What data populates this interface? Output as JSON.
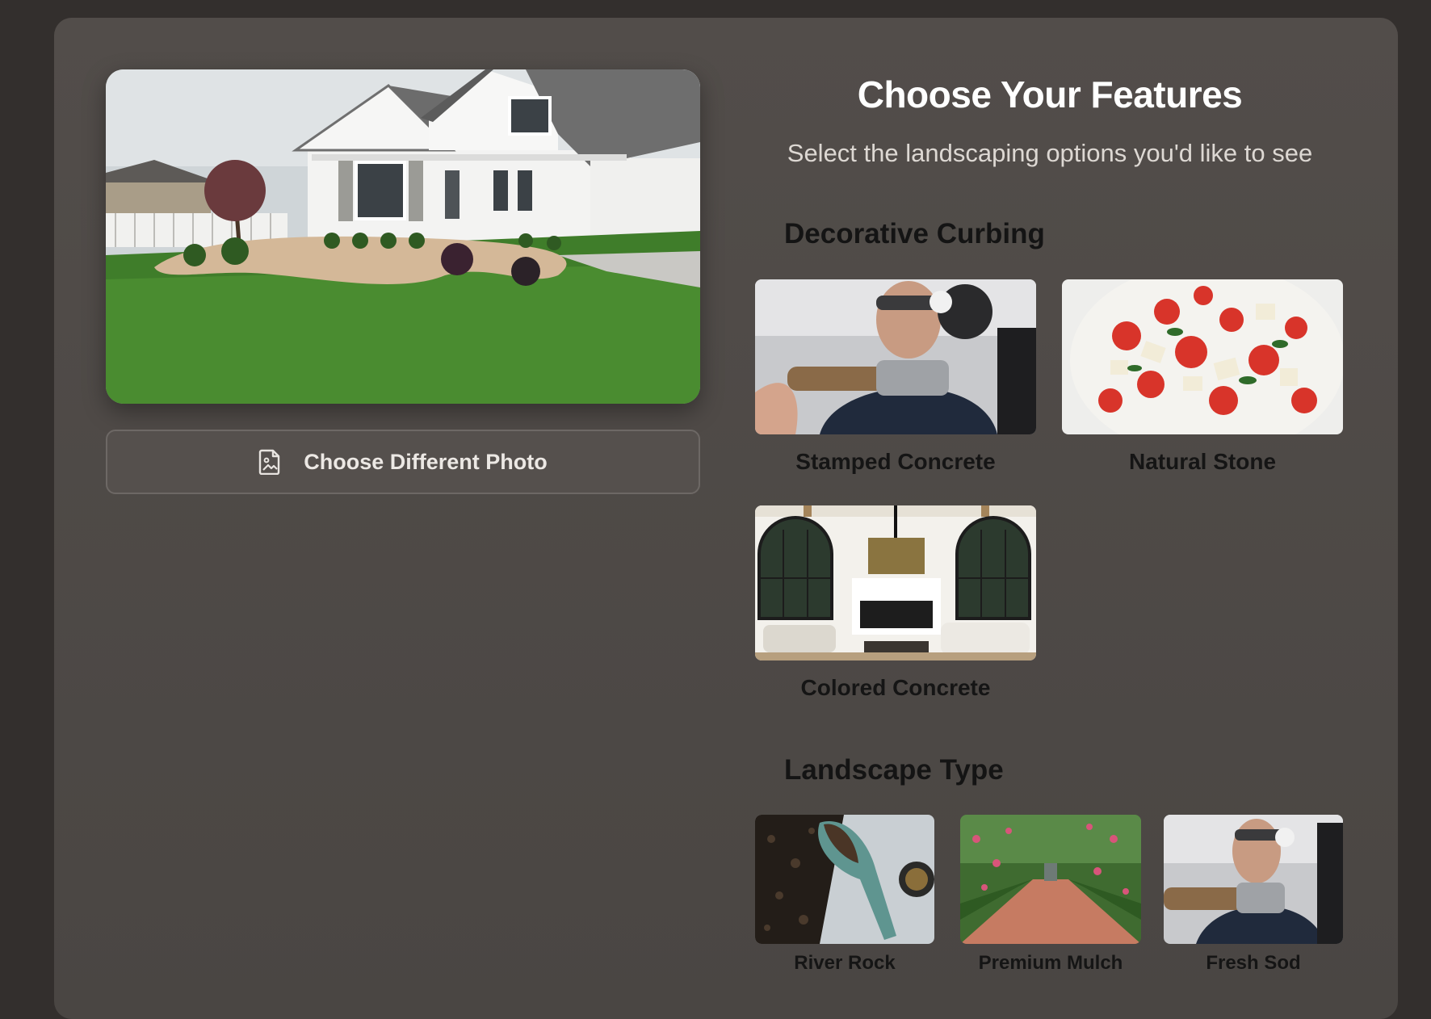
{
  "upload": {
    "photo_alt": "House with landscaped front yard",
    "button_label": "Choose Different Photo",
    "button_icon": "image-file-icon"
  },
  "features": {
    "title": "Choose Your Features",
    "subtitle": "Select the landscaping options you'd like to see",
    "sections": [
      {
        "heading": "Decorative Curbing",
        "options": [
          {
            "label": "Stamped Concrete",
            "thumb": "worker-tool-photo"
          },
          {
            "label": "Natural Stone",
            "thumb": "tomato-salad-photo"
          },
          {
            "label": "Colored Concrete",
            "thumb": "living-room-photo"
          }
        ]
      },
      {
        "heading": "Landscape Type",
        "options": [
          {
            "label": "River Rock",
            "thumb": "soil-trowel-photo"
          },
          {
            "label": "Premium Mulch",
            "thumb": "garden-path-photo"
          },
          {
            "label": "Fresh Sod",
            "thumb": "worker-tool-photo"
          }
        ]
      }
    ]
  },
  "colors": {
    "page_bg": "#332f2d",
    "panel_bg": "#524d4a",
    "title_text": "#ffffff",
    "heading_text": "#141414"
  }
}
